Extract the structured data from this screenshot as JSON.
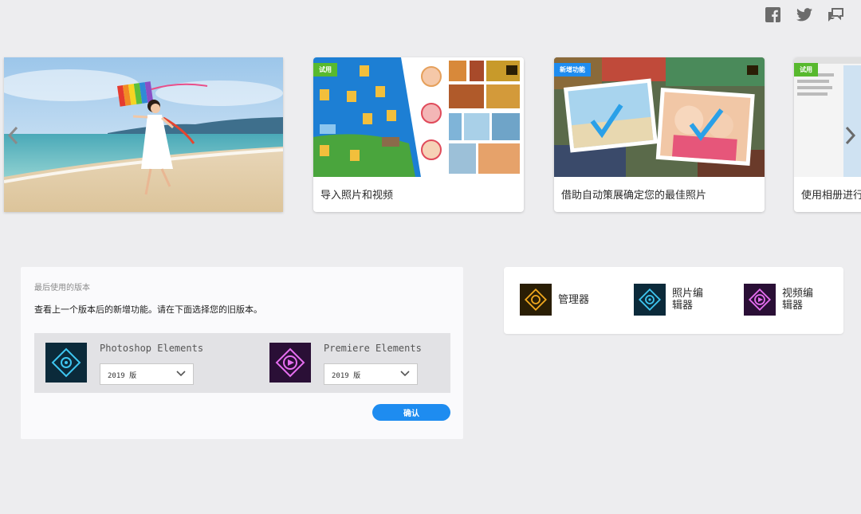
{
  "social": {
    "icons": [
      "facebook-icon",
      "twitter-icon",
      "feedback-icon"
    ]
  },
  "carousel": {
    "cards": [
      {
        "caption": "导入照片和视频",
        "badge": "试用"
      },
      {
        "caption": "借助自动策展确定您的最佳照片",
        "badge": "新增功能"
      },
      {
        "caption": "使用相册进行",
        "badge": "试用"
      }
    ]
  },
  "versions": {
    "heading": "最后使用的版本",
    "description": "查看上一个版本后的新增功能。请在下面选择您的旧版本。",
    "products": [
      {
        "name": "Photoshop Elements",
        "selected": "2019 版"
      },
      {
        "name": "Premiere Elements",
        "selected": "2019 版"
      }
    ],
    "confirm_label": "确认"
  },
  "launch": {
    "apps": [
      {
        "label_line1": "管理器",
        "label_line2": ""
      },
      {
        "label_line1": "照片编",
        "label_line2": "辑器"
      },
      {
        "label_line1": "视频编",
        "label_line2": "辑器"
      }
    ]
  },
  "colors": {
    "accent": "#1e8cf0",
    "badge_green": "#58b92e",
    "badge_blue": "#1e8cf0",
    "ps_icon_bg": "#0b2a3a",
    "pr_icon_bg": "#2a0f36",
    "org_icon_bg": "#2a1e05"
  }
}
